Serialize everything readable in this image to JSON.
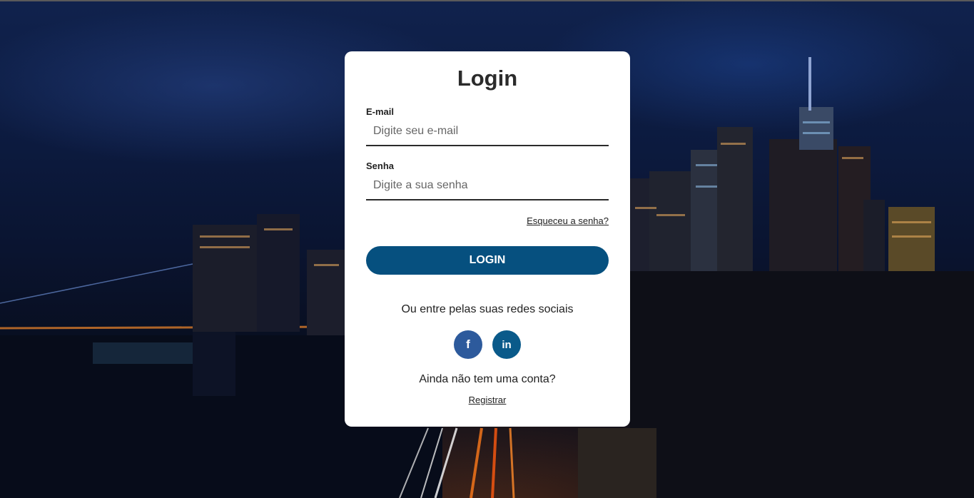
{
  "login": {
    "title": "Login",
    "email_label": "E-mail",
    "email_placeholder": "Digite seu e-mail",
    "password_label": "Senha",
    "password_placeholder": "Digite a sua senha",
    "forgot_link": "Esqueceu a senha?",
    "submit_label": "LOGIN",
    "social_text": "Ou entre pelas suas redes sociais",
    "social": [
      {
        "icon": "facebook-icon",
        "glyph": "f"
      },
      {
        "icon": "linkedin-icon",
        "glyph": "in"
      }
    ],
    "no_account_text": "Ainda não tem uma conta?",
    "register_link": "Registrar"
  },
  "colors": {
    "primary": "#06507f",
    "facebook": "#2d5a9c",
    "linkedin": "#0a5a8a"
  }
}
